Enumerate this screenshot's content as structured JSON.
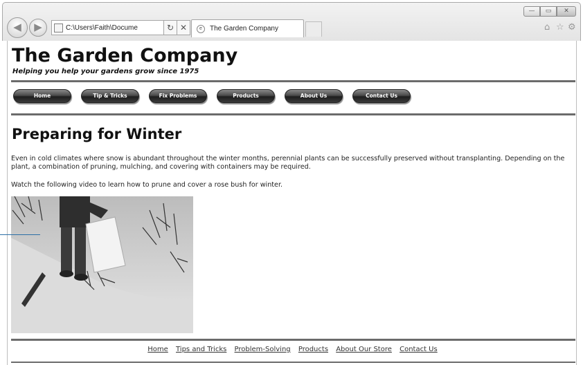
{
  "browser": {
    "address": "C:\\Users\\Faith\\Docume",
    "tab_title": "The Garden Company",
    "back_glyph": "◀",
    "forward_glyph": "▶",
    "window_buttons": [
      "—",
      "▭",
      "✕"
    ],
    "icons": [
      "home-icon",
      "favorites-star-icon",
      "tools-gear-icon",
      "refresh-icon",
      "stop-icon",
      "search-icon"
    ]
  },
  "site": {
    "title": "The Garden Company",
    "tagline": "Helping you help your gardens grow since 1975"
  },
  "nav": {
    "items": [
      "Home",
      "Tip & Tricks",
      "Fix Problems",
      "Products",
      "About Us",
      "Contact Us"
    ]
  },
  "main": {
    "heading": "Preparing for Winter",
    "paragraph1": "Even in cold climates where snow is abundant throughout the winter months, perennial plants can be successfully preserved without transplanting. Depending on the plant, a combination of pruning, mulching, and covering with containers may be required.",
    "paragraph2": "Watch the following video to learn how to prune and cover a rose bush for winter."
  },
  "footer": {
    "links": [
      "Home",
      "Tips and Tricks",
      "Problem-Solving",
      "Products",
      "About Our Store",
      "Contact Us"
    ]
  }
}
